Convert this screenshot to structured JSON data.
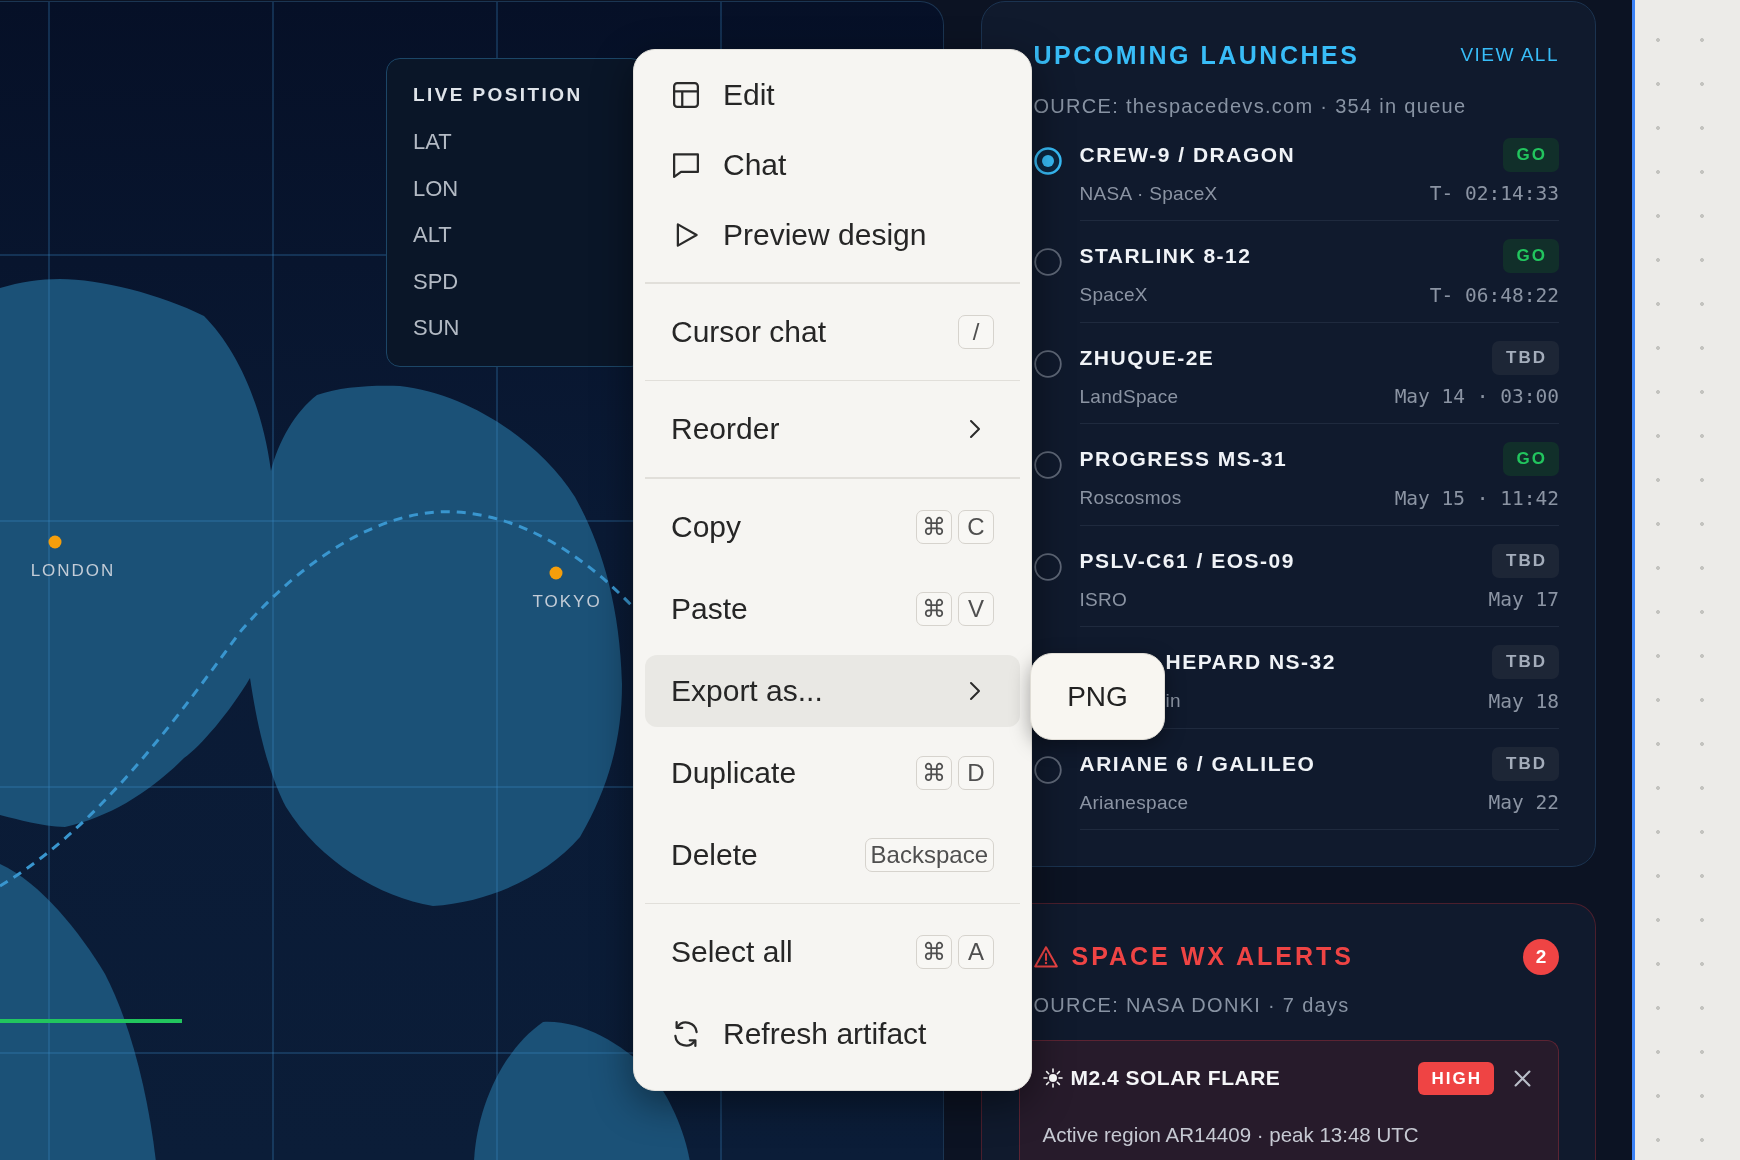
{
  "map": {
    "panel": {
      "title": "LIVE POSITION",
      "fields": [
        "LAT",
        "LON",
        "ALT",
        "SPD",
        "SUN"
      ]
    },
    "cities": [
      "LONDON",
      "TOKYO"
    ]
  },
  "launches": {
    "title": "UPCOMING LAUNCHES",
    "link": "VIEW ALL",
    "source": "OURCE: thespacedevs.com · 354 in queue",
    "rows": [
      {
        "name": "CREW-9 / DRAGON",
        "operator": "NASA · SpaceX",
        "status": "GO",
        "kind": "go",
        "time": "T- 02:14:33",
        "selected": true
      },
      {
        "name": "STARLINK 8-12",
        "operator": "SpaceX",
        "status": "GO",
        "kind": "go",
        "time": "T- 06:48:22",
        "selected": false
      },
      {
        "name": "ZHUQUE-2E",
        "operator": "LandSpace",
        "status": "TBD",
        "kind": "tbd",
        "time": "May 14 · 03:00",
        "selected": false
      },
      {
        "name": "PROGRESS MS-31",
        "operator": "Roscosmos",
        "status": "GO",
        "kind": "go",
        "time": "May 15 · 11:42",
        "selected": false
      },
      {
        "name": "PSLV-C61 / EOS-09",
        "operator": "ISRO",
        "status": "TBD",
        "kind": "tbd",
        "time": "May 17",
        "selected": false
      },
      {
        "name": "HEPARD NS-32",
        "operator": "in",
        "status": "TBD",
        "kind": "tbd",
        "time": "May 18"
      },
      {
        "name": "ARIANE 6 / GALILEO",
        "operator": "Arianespace",
        "status": "TBD",
        "kind": "tbd",
        "time": "May 22",
        "selected": false
      }
    ]
  },
  "alerts": {
    "title": "SPACE WX ALERTS",
    "count": "2",
    "source": "OURCE: NASA DONKI · 7 days",
    "items": [
      {
        "title": "M2.4 SOLAR FLARE",
        "severity": "HIGH",
        "text": "Active region AR14409 · peak 13:48 UTC"
      }
    ]
  },
  "context_menu": {
    "groups": [
      [
        {
          "label": "Edit",
          "kind": "icon",
          "selected": false
        },
        {
          "label": "Chat",
          "kind": "icon",
          "selected": false
        },
        {
          "label": "Preview design",
          "kind": "icon",
          "selected": false
        }
      ],
      [
        {
          "label": "Cursor chat",
          "kind": "shortcut",
          "keys": [
            "/"
          ],
          "selected": false
        }
      ],
      [
        {
          "label": "Reorder",
          "kind": "submenu",
          "selected": false
        }
      ],
      [
        {
          "label": "Copy",
          "kind": "shortcut",
          "keys": [
            "⌘",
            "C"
          ],
          "selected": false
        },
        {
          "label": "Paste",
          "kind": "shortcut",
          "keys": [
            "⌘",
            "V"
          ],
          "selected": false
        },
        {
          "label": "Export as...",
          "kind": "submenu",
          "selected": true
        },
        {
          "label": "Duplicate",
          "kind": "shortcut",
          "keys": [
            "⌘",
            "D"
          ],
          "selected": false
        },
        {
          "label": "Delete",
          "kind": "shortcut",
          "keys": [
            "Backspace"
          ],
          "selected": false
        }
      ],
      [
        {
          "label": "Select all",
          "kind": "shortcut",
          "keys": [
            "⌘",
            "A"
          ],
          "selected": false
        },
        {
          "label": "Refresh artifact",
          "kind": "icon",
          "selected": false
        }
      ]
    ],
    "submenu": [
      "PNG"
    ]
  }
}
